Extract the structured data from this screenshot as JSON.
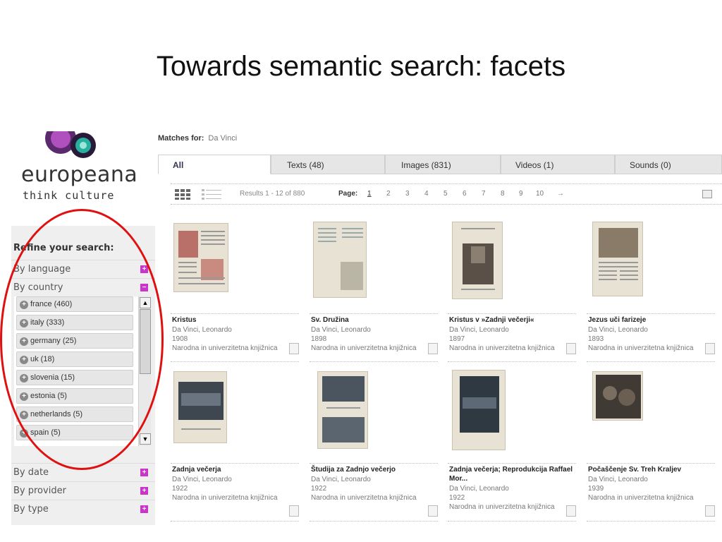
{
  "slide": {
    "title": "Towards semantic search: facets"
  },
  "logo": {
    "wordmark": "europeana",
    "tagline": "think culture"
  },
  "sidebar": {
    "refine_title": "Refine your search:",
    "facets_top": [
      {
        "label": "By language",
        "toggle": "+"
      },
      {
        "label": "By country",
        "toggle": "−"
      }
    ],
    "countries": [
      "france (460)",
      "italy (333)",
      "germany (25)",
      "uk (18)",
      "slovenia (15)",
      "estonia (5)",
      "netherlands (5)",
      "spain (5)"
    ],
    "facets_bottom": [
      {
        "label": "By date",
        "toggle": "+"
      },
      {
        "label": "By provider",
        "toggle": "+"
      },
      {
        "label": "By type",
        "toggle": "+"
      }
    ]
  },
  "search": {
    "matches_label": "Matches for:",
    "query": "Da Vinci"
  },
  "tabs": [
    {
      "label": "All"
    },
    {
      "label": "Texts (48)"
    },
    {
      "label": "Images (831)"
    },
    {
      "label": "Videos (1)"
    },
    {
      "label": "Sounds (0)"
    }
  ],
  "toolbar": {
    "results_count": "Results 1 - 12 of 880",
    "page_label": "Page:",
    "pages": [
      "1",
      "2",
      "3",
      "4",
      "5",
      "6",
      "7",
      "8",
      "9",
      "10",
      "→"
    ]
  },
  "results": [
    {
      "title": "Kristus",
      "author": "Da Vinci, Leonardo",
      "year": "1908",
      "provider": "Narodna in univerzitetna knjižnica"
    },
    {
      "title": "Sv. Družina",
      "author": "Da Vinci, Leonardo",
      "year": "1898",
      "provider": "Narodna in univerzitetna knjižnica"
    },
    {
      "title": "Kristus v »Zadnji večerji«",
      "author": "Da Vinci, Leonardo",
      "year": "1897",
      "provider": "Narodna in univerzitetna knjižnica"
    },
    {
      "title": "Jezus uči farizeje",
      "author": "Da Vinci, Leonardo",
      "year": "1893",
      "provider": "Narodna in univerzitetna knjižnica"
    },
    {
      "title": "Zadnja večerja",
      "author": "Da Vinci, Leonardo",
      "year": "1922",
      "provider": "Narodna in univerzitetna knjižnica"
    },
    {
      "title": "Študija za Zadnjo večerjo",
      "author": "Da Vinci, Leonardo",
      "year": "1922",
      "provider": "Narodna in univerzitetna knjižnica"
    },
    {
      "title": "Zadnja večerja; Reprodukcija Raffael Mor...",
      "author": "Da Vinci, Leonardo",
      "year": "1922",
      "provider": "Narodna in univerzitetna knjižnica"
    },
    {
      "title": "Počaščenje Sv. Treh Kraljev",
      "author": "Da Vinci, Leonardo",
      "year": "1939",
      "provider": "Narodna in univerzitetna knjižnica"
    }
  ]
}
